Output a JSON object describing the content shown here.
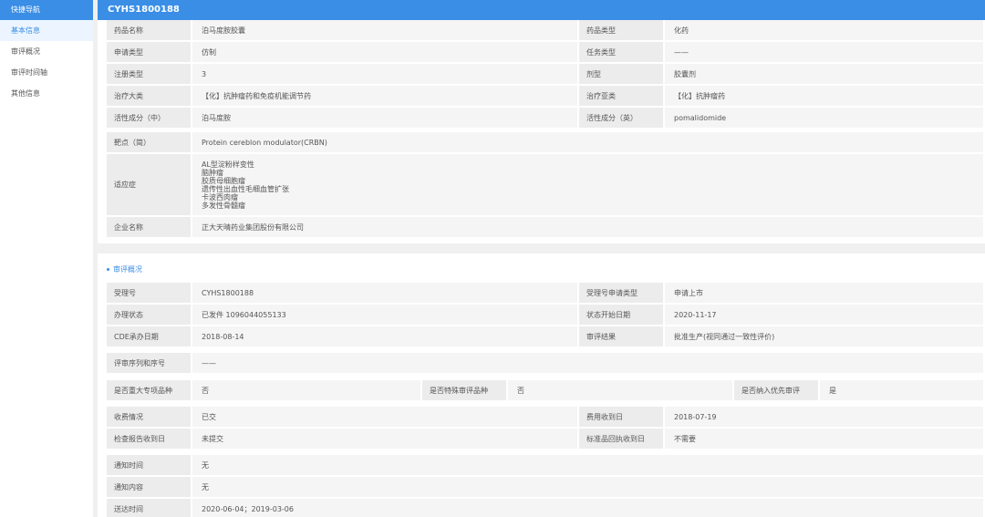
{
  "sidebar": {
    "header": "快捷导航",
    "items": [
      "基本信息",
      "审评概况",
      "审评时间轴",
      "其他信息"
    ]
  },
  "title": "CYHS1800188",
  "basic": {
    "drug_name_label": "药品名称",
    "drug_name": "泊马度胺胶囊",
    "drug_type_label": "药品类型",
    "drug_type": "化药",
    "apply_type_label": "申请类型",
    "apply_type": "仿制",
    "task_type_label": "任务类型",
    "task_type": "——",
    "reg_type_label": "注册类型",
    "reg_type": "3",
    "dosage_label": "剂型",
    "dosage": "胶囊剂",
    "category_label": "治疗大类",
    "category": "【化】抗肿瘤药和免疫机能调节药",
    "subcategory_label": "治疗亚类",
    "subcategory": "【化】抗肿瘤药",
    "ingredient_cn_label": "活性成分（中）",
    "ingredient_cn": "泊马度胺",
    "ingredient_en_label": "活性成分（英）",
    "ingredient_en": "pomalidomide",
    "target_label": "靶点（简）",
    "target": "Protein cereblon modulator(CRBN)",
    "indication_label": "适应症",
    "indications": [
      "AL型淀粉样变性",
      "脑肿瘤",
      "胶质母细胞瘤",
      "遗传性出血性毛细血管扩张",
      "卡波西肉瘤",
      "多发性骨髓瘤"
    ],
    "company_label": "企业名称",
    "company": "正大天晴药业集团股份有限公司"
  },
  "review": {
    "section_title": "审评概况",
    "accept_no_label": "受理号",
    "accept_no": "CYHS1800188",
    "accept_type_label": "受理号申请类型",
    "accept_type": "申请上市",
    "status_label": "办理状态",
    "status": "已发件 1096044055133",
    "status_date_label": "状态开始日期",
    "status_date": "2020-11-17",
    "cde_date_label": "CDE承办日期",
    "cde_date": "2018-08-14",
    "result_label": "审评结果",
    "result": "批准生产(视同通过一致性评价)",
    "seq_label": "评审序列和序号",
    "seq": "——",
    "major_label": "是否重大专项品种",
    "major": "否",
    "special_label": "是否特殊审评品种",
    "special": "否",
    "priority_label": "是否纳入优先审评",
    "priority": "是",
    "fee_label": "收费情况",
    "fee": "已交",
    "fee_date_label": "费用收到日",
    "fee_date": "2018-07-19",
    "report_label": "检查报告收到日",
    "report": "未提交",
    "standard_label": "标准品回执收到日",
    "standard": "不需要",
    "notice_time_label": "通知时间",
    "notice_time": "无",
    "notice_content_label": "通知内容",
    "notice_content": "无",
    "send_time_label": "送达时间",
    "send_time": "2020-06-04；2019-03-06"
  }
}
